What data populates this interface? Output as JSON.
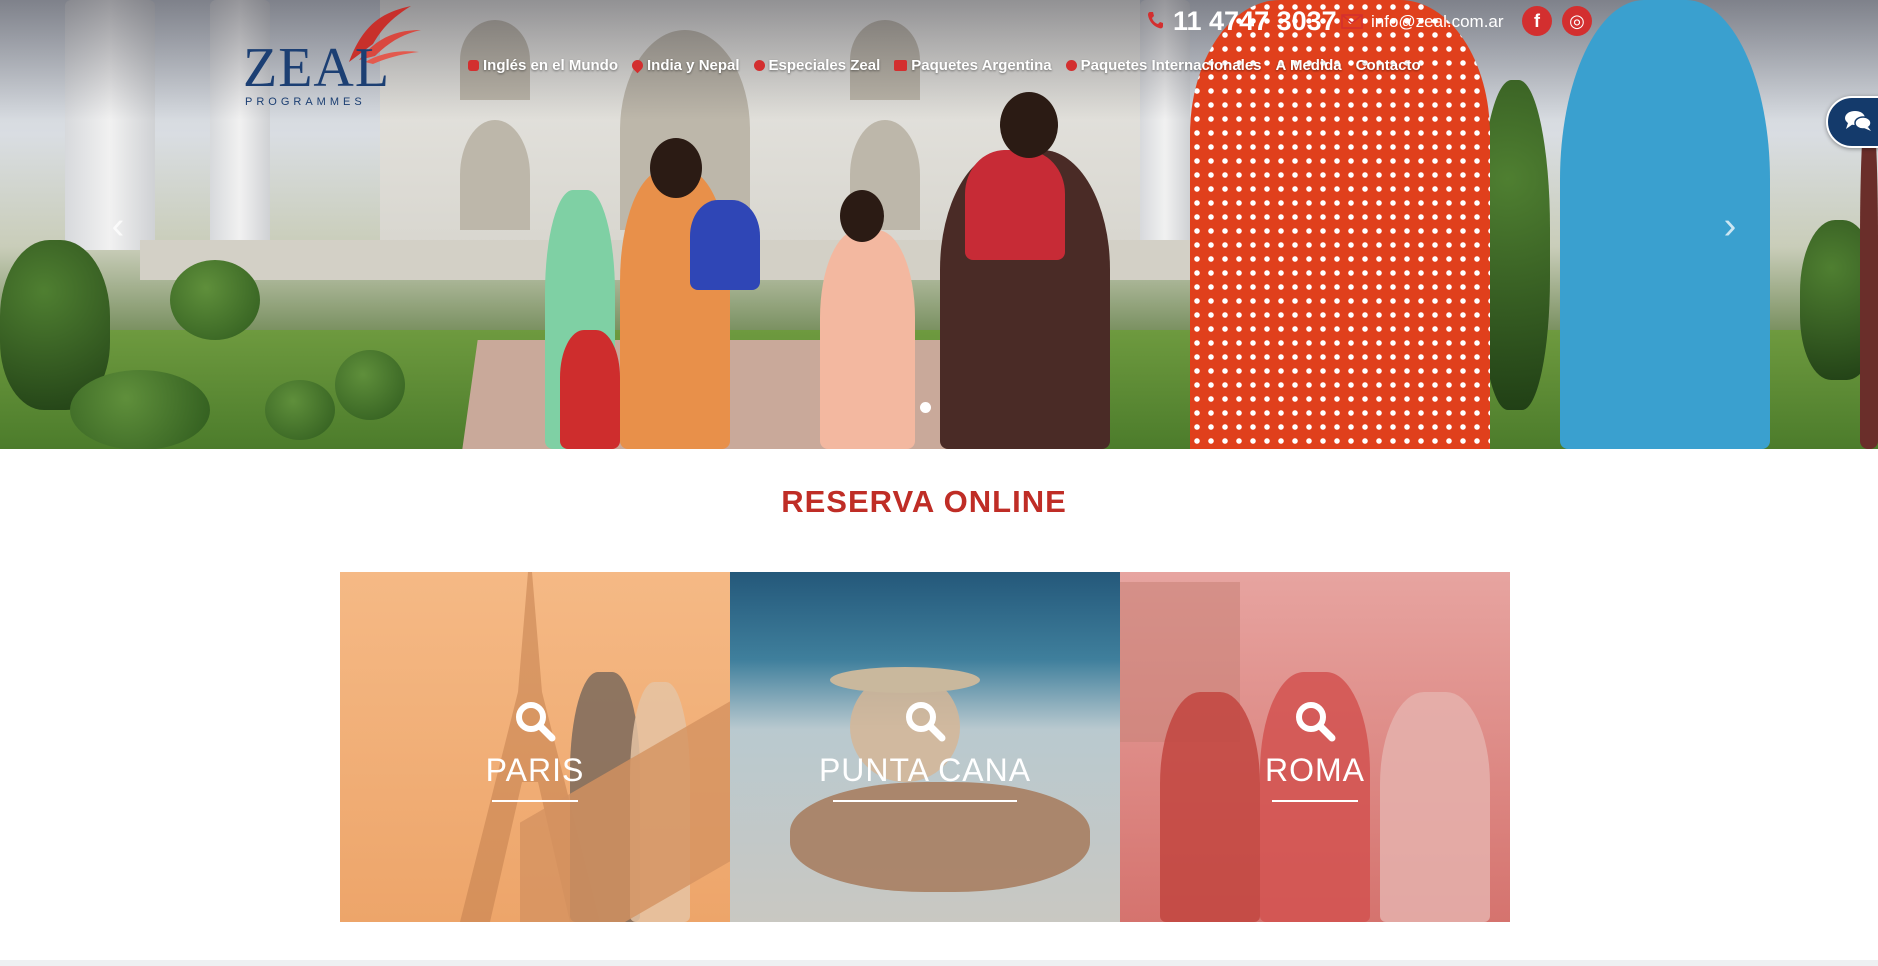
{
  "header": {
    "logo": {
      "word": "ZEAL",
      "subtitle": "PROGRAMMES"
    },
    "phone": "11 4747 3037",
    "email": "info@zeal.com.ar",
    "social": [
      {
        "icon": "facebook-icon",
        "glyph": "f"
      },
      {
        "icon": "instagram-icon",
        "glyph": "◎"
      }
    ],
    "accent_color": "#d32f2f",
    "brand_color": "#1c3f73"
  },
  "nav": {
    "items": [
      {
        "label": "Inglés en el Mundo",
        "icon": "speech-bubble-icon"
      },
      {
        "label": "India y Nepal",
        "icon": "map-pin-icon"
      },
      {
        "label": "Especiales Zeal",
        "icon": "star-icon"
      },
      {
        "label": "Paquetes Argentina",
        "icon": "suitcase-icon"
      },
      {
        "label": "Paquetes Internacionales",
        "icon": "globe-icon"
      },
      {
        "label": "A Medida",
        "icon": ""
      },
      {
        "label": "Contacto",
        "icon": ""
      }
    ]
  },
  "hero": {
    "prev_glyph": "‹",
    "next_glyph": "›",
    "active_slide": 1
  },
  "reserva": {
    "title": "RESERVA ONLINE",
    "title_color": "#bf2d26",
    "cards": [
      {
        "label": "PARIS",
        "overlay_color": "#f2a66b"
      },
      {
        "label": "PUNTA CANA",
        "overlay_color": "#355d78"
      },
      {
        "label": "ROMA",
        "overlay_color": "#d3736f"
      }
    ]
  }
}
